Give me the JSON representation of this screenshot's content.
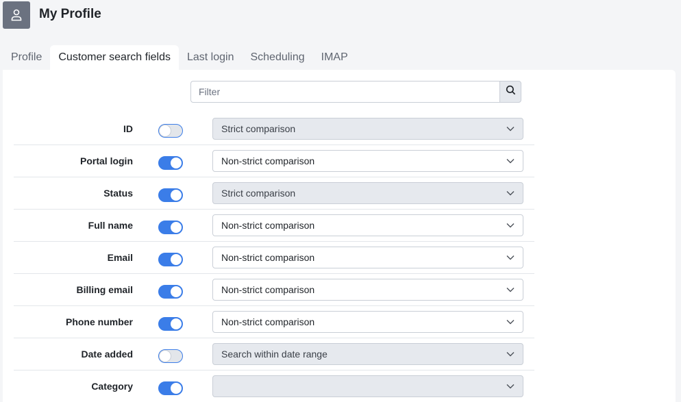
{
  "header": {
    "title": "My Profile",
    "icon": "user-icon"
  },
  "tabs": [
    {
      "label": "Profile",
      "active": false
    },
    {
      "label": "Customer search fields",
      "active": true
    },
    {
      "label": "Last login",
      "active": false
    },
    {
      "label": "Scheduling",
      "active": false
    },
    {
      "label": "IMAP",
      "active": false
    }
  ],
  "filter": {
    "placeholder": "Filter",
    "value": "",
    "button_icon": "search-icon"
  },
  "colors": {
    "accent": "#3b7de8",
    "disabled_select_bg": "#e6e9ee"
  },
  "fields": [
    {
      "label": "ID",
      "enabled": false,
      "comparison": "Strict comparison"
    },
    {
      "label": "Portal login",
      "enabled": true,
      "comparison": "Non-strict comparison"
    },
    {
      "label": "Status",
      "enabled": true,
      "comparison": "Strict comparison"
    },
    {
      "label": "Full name",
      "enabled": true,
      "comparison": "Non-strict comparison"
    },
    {
      "label": "Email",
      "enabled": true,
      "comparison": "Non-strict comparison"
    },
    {
      "label": "Billing email",
      "enabled": true,
      "comparison": "Non-strict comparison"
    },
    {
      "label": "Phone number",
      "enabled": true,
      "comparison": "Non-strict comparison"
    },
    {
      "label": "Date added",
      "enabled": false,
      "comparison": "Search within date range"
    },
    {
      "label": "Category",
      "enabled": true,
      "comparison": ""
    }
  ],
  "select_disabled": [
    true,
    false,
    true,
    false,
    false,
    false,
    false,
    true,
    true
  ]
}
